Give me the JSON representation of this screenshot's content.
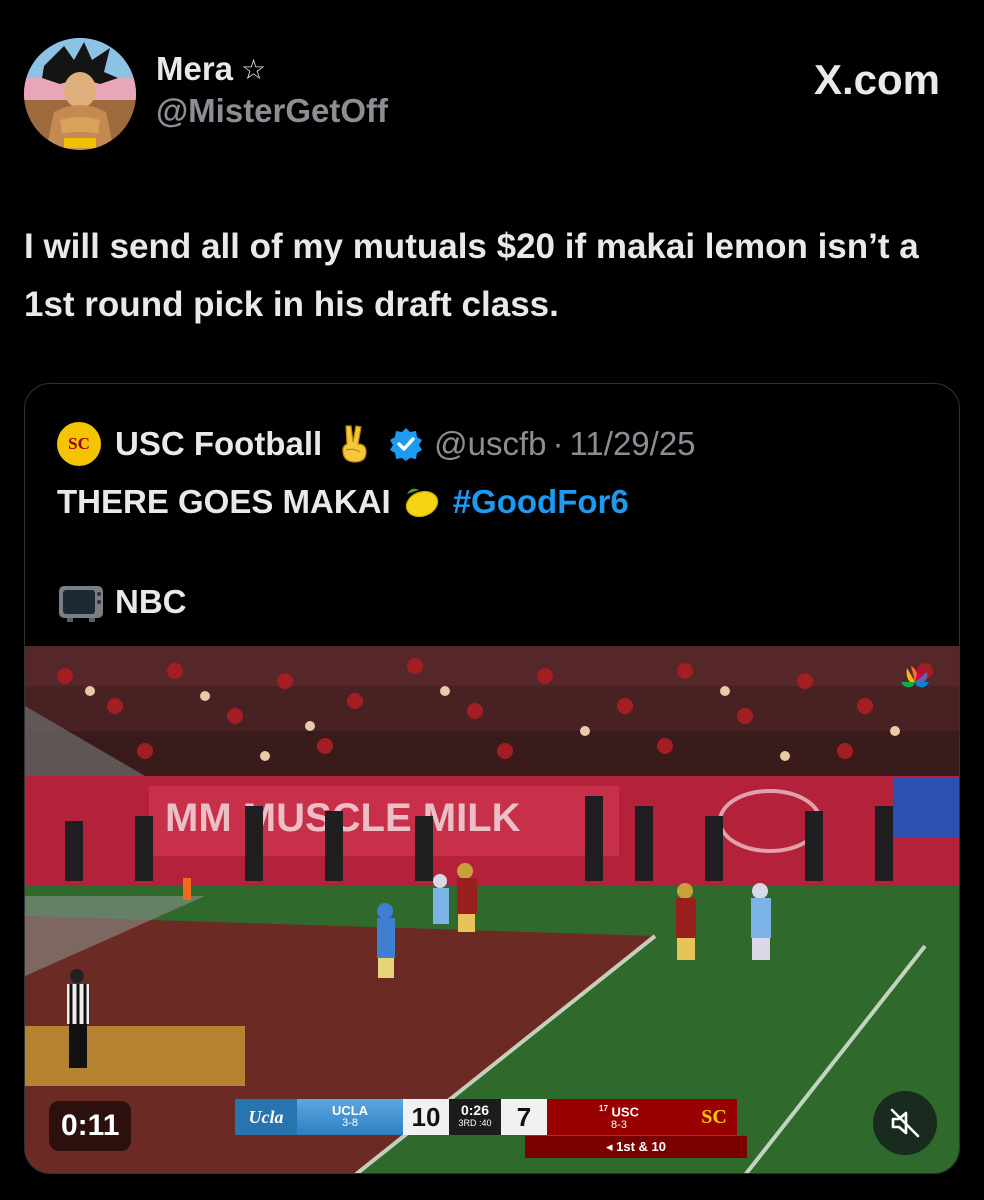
{
  "header": {
    "display_name": "Mera",
    "name_symbol": "☆",
    "handle": "@MisterGetOff",
    "brand": "X.com"
  },
  "tweet": {
    "text": "I will send all of my mutuals $20 if makai lemon isn’t a 1st round pick in his draft class."
  },
  "quote": {
    "logo_text": "SC",
    "name": "USC Football",
    "handle": "@uscfb",
    "separator": "·",
    "date": "11/29/25",
    "line1": "THERE GOES MAKAI",
    "hashtag": "#GoodFor6",
    "line2": "NBC"
  },
  "video": {
    "duration": "0:11",
    "scorebug": {
      "home_logo": "Ucla",
      "home_team": "UCLA",
      "home_record": "3-8",
      "home_score": "10",
      "clock": "0:26",
      "quarter": "3RD :40",
      "away_score": "7",
      "away_rank": "17",
      "away_team": "USC",
      "away_record": "8-3",
      "away_logo": "SC",
      "down_distance": "◂ 1st & 10"
    }
  },
  "colors": {
    "background": "#000000",
    "text_primary": "#e7e9ea",
    "text_secondary": "#8b8f94",
    "link": "#1d9bf0",
    "card_border": "#2f3336"
  },
  "icons": {
    "verified": "verified-badge-icon",
    "victory_hand": "victory-hand-emoji",
    "lemon": "lemon-emoji",
    "tv": "television-emoji",
    "mute": "speaker-muted-icon"
  }
}
